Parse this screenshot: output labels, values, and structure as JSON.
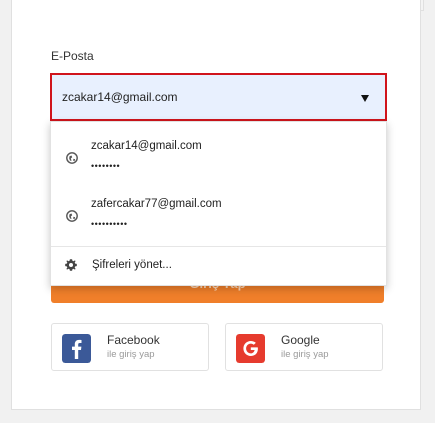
{
  "form": {
    "email_label": "E-Posta",
    "email_value": "zcakar14@gmail.com",
    "submit_label": "Giriş Yap"
  },
  "autofill": {
    "accounts": [
      {
        "email": "zcakar14@gmail.com",
        "password_mask": "••••••••"
      },
      {
        "email": "zafercakar77@gmail.com",
        "password_mask": "••••••••••"
      }
    ],
    "manage_label": "Şifreleri yönet..."
  },
  "social": {
    "facebook": {
      "name": "Facebook",
      "subtitle": "ile giriş yap",
      "color": "#3b5998"
    },
    "google": {
      "name": "Google",
      "subtitle": "ile giriş yap",
      "color": "#e63b2e"
    }
  },
  "colors": {
    "accent_orange": "#f07f2a",
    "focus_border": "#d0141c",
    "autofill_bg": "#e8f0fe"
  }
}
